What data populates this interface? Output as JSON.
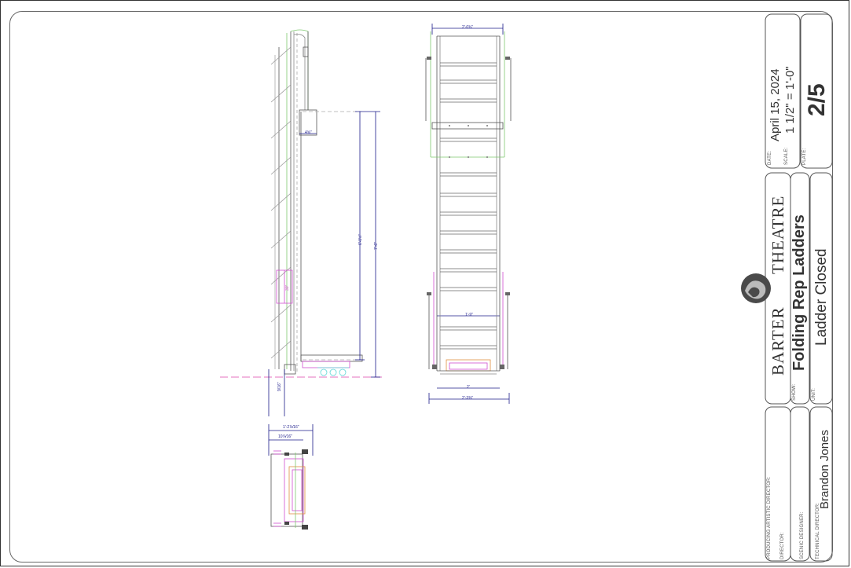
{
  "title_block": {
    "date_label": "DATE:",
    "date_value": "April 15, 2024",
    "scale_label": "SCALE:",
    "scale_value": "1 1/2\" = 1'-0\"",
    "plate_label": "PLATE:",
    "plate_value": "2/5",
    "logo_left": "BARTER",
    "logo_right": "THEATRE",
    "show_label": "SHOW:",
    "show_value": "Folding Rep Ladders",
    "unit_label": "UNIT:",
    "unit_value": "Ladder Closed",
    "producing_label": "PRODUCING ARTISTIC DIRECTOR:",
    "director_label": "DIRECTOR:",
    "scenic_label": "SCENIC DESIGNER:",
    "td_label": "TECHNICAL DIRECTOR:",
    "td_value": "Brandon Jones"
  },
  "dimensions": {
    "side_top": "4⅝\"",
    "side_inner": "6'-1½\"",
    "side_total": "7'-6\"",
    "side_foot": "9/16\"",
    "side_mark": "30\"",
    "plan_outer": "1'-2⅞⁄16\"",
    "plan_inner": "10⅞⁄16\"",
    "front_top": "2'-0¾\"",
    "front_mid": "1'-9\"",
    "front_base": "2'",
    "front_total": "2'-3⅜\""
  },
  "colors": {
    "line": "#555555",
    "dim": "#1b1b8a",
    "green": "#7ec86f",
    "magenta": "#d04fd0",
    "cyan": "#5fd6d6",
    "orange": "#e09040",
    "gray": "#aaaaaa"
  }
}
